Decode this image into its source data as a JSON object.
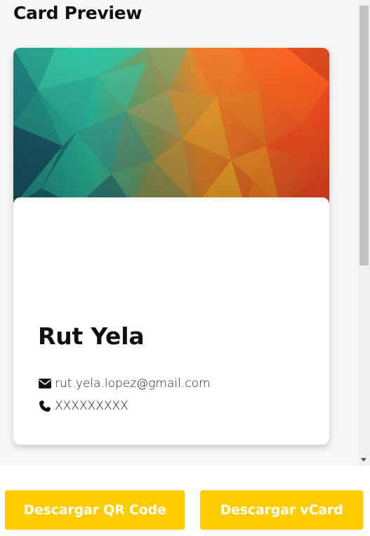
{
  "card_preview": {
    "title": "Card Preview",
    "name": "Rut Yela",
    "email": "rut.yela.lopez@gmail.com",
    "phone": "XXXXXXXXX",
    "email_icon": "envelope-icon",
    "phone_icon": "phone-icon"
  },
  "actions": {
    "qr_label": "Descargar QR Code",
    "vcard_label": "Descargar vCard"
  },
  "colors": {
    "button": "#ffcc00",
    "button_text": "#ffffff",
    "banner_left": "#2bbf9f",
    "banner_right": "#ff5a1f"
  }
}
